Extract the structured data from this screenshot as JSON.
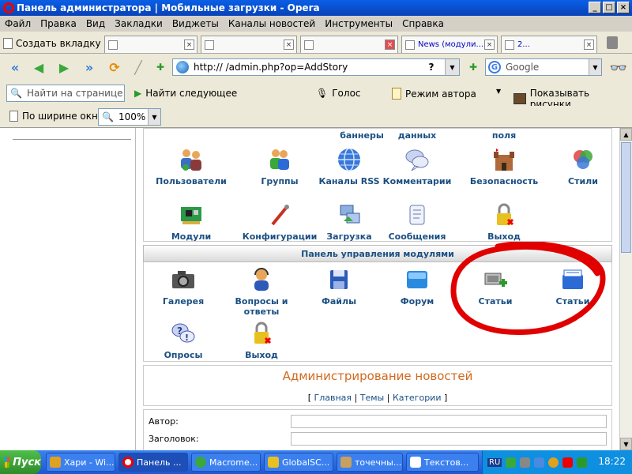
{
  "window": {
    "title": "Панель администратора | Мобильные загрузки - Opera"
  },
  "menu": [
    "Файл",
    "Правка",
    "Вид",
    "Закладки",
    "Виджеты",
    "Каналы новостей",
    "Инструменты",
    "Справка"
  ],
  "tabs": {
    "new_tab": "Создать вкладку",
    "items": [
      "",
      "",
      "",
      "News (модули...",
      "2..."
    ]
  },
  "nav": {
    "url": "http://          /admin.php?op=AddStory",
    "search_placeholder": "Google"
  },
  "findbar": {
    "find_placeholder": "Найти на странице",
    "find_next": "Найти следующее",
    "voice": "Голос",
    "author_mode": "Режим автора",
    "show_images": "Показывать рисунки"
  },
  "zoombar": {
    "fit_width": "По ширине окна",
    "zoom": "100%"
  },
  "admin": {
    "top_partial": [
      "баннеры",
      "данных",
      "поля"
    ],
    "row1": [
      "Пользователи",
      "Группы",
      "Каналы RSS",
      "Комментарии",
      "Безопасность",
      "Стили"
    ],
    "row2": [
      "Модули",
      "Конфигурации",
      "Загрузка",
      "Сообщения",
      "Выход"
    ],
    "modules_header": "Панель управления модулями",
    "row3": [
      "Галерея",
      "Вопросы и ответы",
      "Файлы",
      "Форум",
      "Статьи",
      "Статьи"
    ],
    "row4": [
      "Опросы",
      "Выход"
    ]
  },
  "news": {
    "title": "Администрирование новостей",
    "bracket_open": "[",
    "bracket_close": "]",
    "sep": "|",
    "links": [
      "Главная",
      "Темы",
      "Категории"
    ]
  },
  "form": {
    "author": "Автор:",
    "headline": "Заголовок:"
  },
  "taskbar": {
    "start": "Пуск",
    "tasks": [
      "Хари - Wi...",
      "Панель ...",
      "Macrome...",
      "GlobalSC...",
      "точечны...",
      "Текстов..."
    ],
    "lang": "RU",
    "clock": "18:22"
  },
  "colors": {
    "link": "#1a4f82",
    "news_title": "#d2691e",
    "annotation": "#e00000"
  }
}
